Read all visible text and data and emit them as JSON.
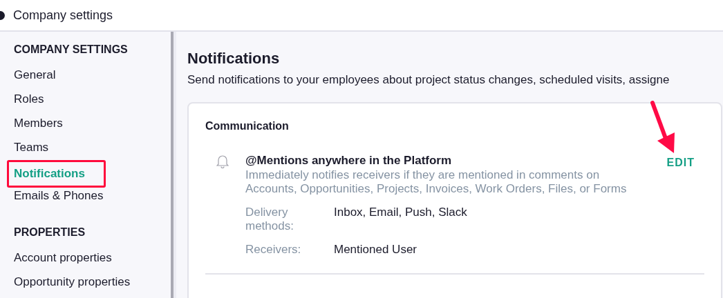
{
  "window": {
    "title": "Company settings"
  },
  "sidebar": {
    "sections": [
      {
        "heading": "COMPANY SETTINGS",
        "items": [
          {
            "label": "General",
            "selected": false,
            "highlighted": false
          },
          {
            "label": "Roles",
            "selected": false,
            "highlighted": false
          },
          {
            "label": "Members",
            "selected": false,
            "highlighted": false
          },
          {
            "label": "Teams",
            "selected": false,
            "highlighted": false
          },
          {
            "label": "Notifications",
            "selected": true,
            "highlighted": true
          },
          {
            "label": "Emails & Phones",
            "selected": false,
            "highlighted": false
          }
        ]
      },
      {
        "heading": "PROPERTIES",
        "items": [
          {
            "label": "Account properties",
            "selected": false,
            "highlighted": false
          },
          {
            "label": "Opportunity properties",
            "selected": false,
            "highlighted": false
          }
        ]
      }
    ]
  },
  "main": {
    "title": "Notifications",
    "description": "Send notifications to your employees about project status changes, scheduled visits, assigne",
    "card": {
      "title": "Communication",
      "notifications": [
        {
          "title": "@Mentions anywhere in the Platform",
          "description": "Immediately notifies receivers if they are mentioned in comments on Accounts, Opportunities, Projects, Invoices, Work Orders, Files, or Forms",
          "action": "EDIT",
          "pointed": true,
          "details": [
            {
              "label": "Delivery methods:",
              "value": "Inbox, Email, Push, Slack"
            },
            {
              "label": "Receivers:",
              "value": "Mentioned User"
            }
          ]
        }
      ]
    }
  }
}
